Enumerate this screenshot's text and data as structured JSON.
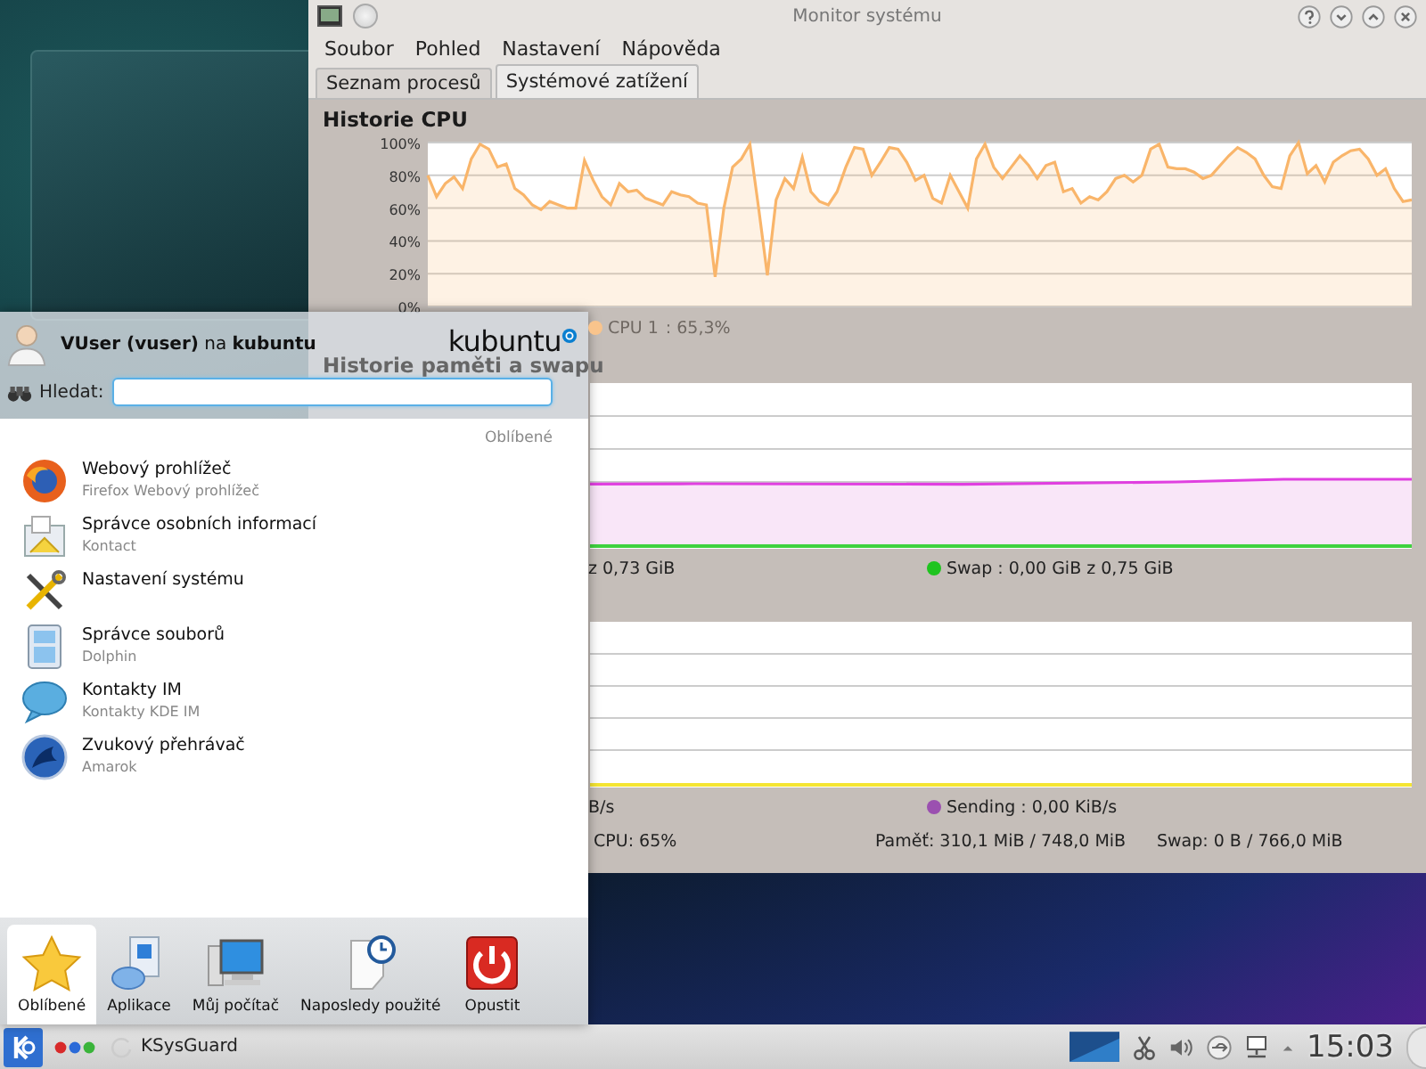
{
  "window": {
    "title": "Monitor systému"
  },
  "menu_bar": [
    "Soubor",
    "Pohled",
    "Nastavení",
    "Nápověda"
  ],
  "tabs": [
    {
      "label": "Seznam procesů",
      "selected": false
    },
    {
      "label": "Systémové zatížení",
      "selected": true
    }
  ],
  "cpu": {
    "title": "Historie CPU",
    "legend": [
      {
        "value": ": 65,3%",
        "color": "#f9c48c"
      }
    ],
    "chart_data": {
      "type": "area",
      "grid": true,
      "ylim": [
        0,
        100
      ],
      "yticks": [
        {
          "value": 0,
          "label": "0%"
        },
        {
          "value": 20,
          "label": "20%"
        },
        {
          "value": 40,
          "label": "40%"
        },
        {
          "value": 60,
          "label": "60%"
        },
        {
          "value": 80,
          "label": "80%"
        },
        {
          "value": 100,
          "label": "100%"
        }
      ],
      "series": [
        {
          "name": "CPU 1",
          "color": "#f9b56a",
          "values": [
            80,
            67,
            75,
            79,
            72,
            90,
            99,
            96,
            85,
            87,
            72,
            68,
            62,
            59,
            64,
            62,
            60,
            60,
            89,
            77,
            67,
            62,
            75,
            70,
            71,
            66,
            64,
            62,
            70,
            68,
            67,
            63,
            62,
            18,
            60,
            85,
            90,
            99,
            60,
            19,
            65,
            78,
            72,
            91,
            70,
            64,
            62,
            70,
            85,
            97,
            96,
            80,
            88,
            97,
            96,
            88,
            77,
            80,
            66,
            63,
            80,
            70,
            60,
            90,
            99,
            85,
            78,
            85,
            92,
            86,
            78,
            86,
            88,
            70,
            72,
            63,
            67,
            65,
            70,
            78,
            80,
            76,
            80,
            96,
            99,
            85,
            84,
            84,
            82,
            78,
            80,
            86,
            92,
            97,
            94,
            90,
            80,
            73,
            72,
            92,
            100,
            81,
            86,
            76,
            88,
            92,
            95,
            96,
            90,
            80,
            84,
            72,
            64,
            65
          ]
        }
      ]
    }
  },
  "memory": {
    "title": "Historie paměti a swapu",
    "legend": [
      {
        "text": "z 0,73 GiB"
      },
      {
        "text": "Swap : 0,00 GiB z 0,75 GiB",
        "color": "#1fc41f"
      }
    ]
  },
  "network": {
    "legend": [
      {
        "text": "B/s"
      },
      {
        "text": "Sending : 0,00 KiB/s",
        "color": "#9b50b0"
      }
    ]
  },
  "status_bar": [
    "CPU: 65%",
    "Paměť: 310,1 MiB / 748,0 MiB",
    "Swap: 0 B / 766,0 MiB"
  ],
  "launcher": {
    "user": "**VUser (vuser)** na **kubuntu**",
    "logo": "kubuntu",
    "search": {
      "label": "Hledat:"
    },
    "section": "Oblíbené",
    "items": [
      {
        "name": "Webový prohlížeč",
        "description": "Firefox Webový prohlížeč"
      },
      {
        "name": "Správce osobních informací",
        "description": "Kontact"
      },
      {
        "name": "Nastavení systému"
      },
      {
        "name": "Správce souborů",
        "description": "Dolphin"
      },
      {
        "name": "Kontakty IM",
        "description": "Kontakty KDE IM"
      },
      {
        "name": "Zvukový přehrávač",
        "description": "Amarok"
      }
    ],
    "tabs": [
      {
        "label": "Oblíbené",
        "selected": true
      },
      {
        "label": "Aplikace",
        "selected": false
      },
      {
        "label": "Můj počítač",
        "selected": false
      },
      {
        "label": "Naposledy použité",
        "selected": false
      },
      {
        "label": "Opustit",
        "selected": false
      }
    ]
  },
  "taskbar": {
    "task": "KSysGuard",
    "clock": "15:03"
  }
}
